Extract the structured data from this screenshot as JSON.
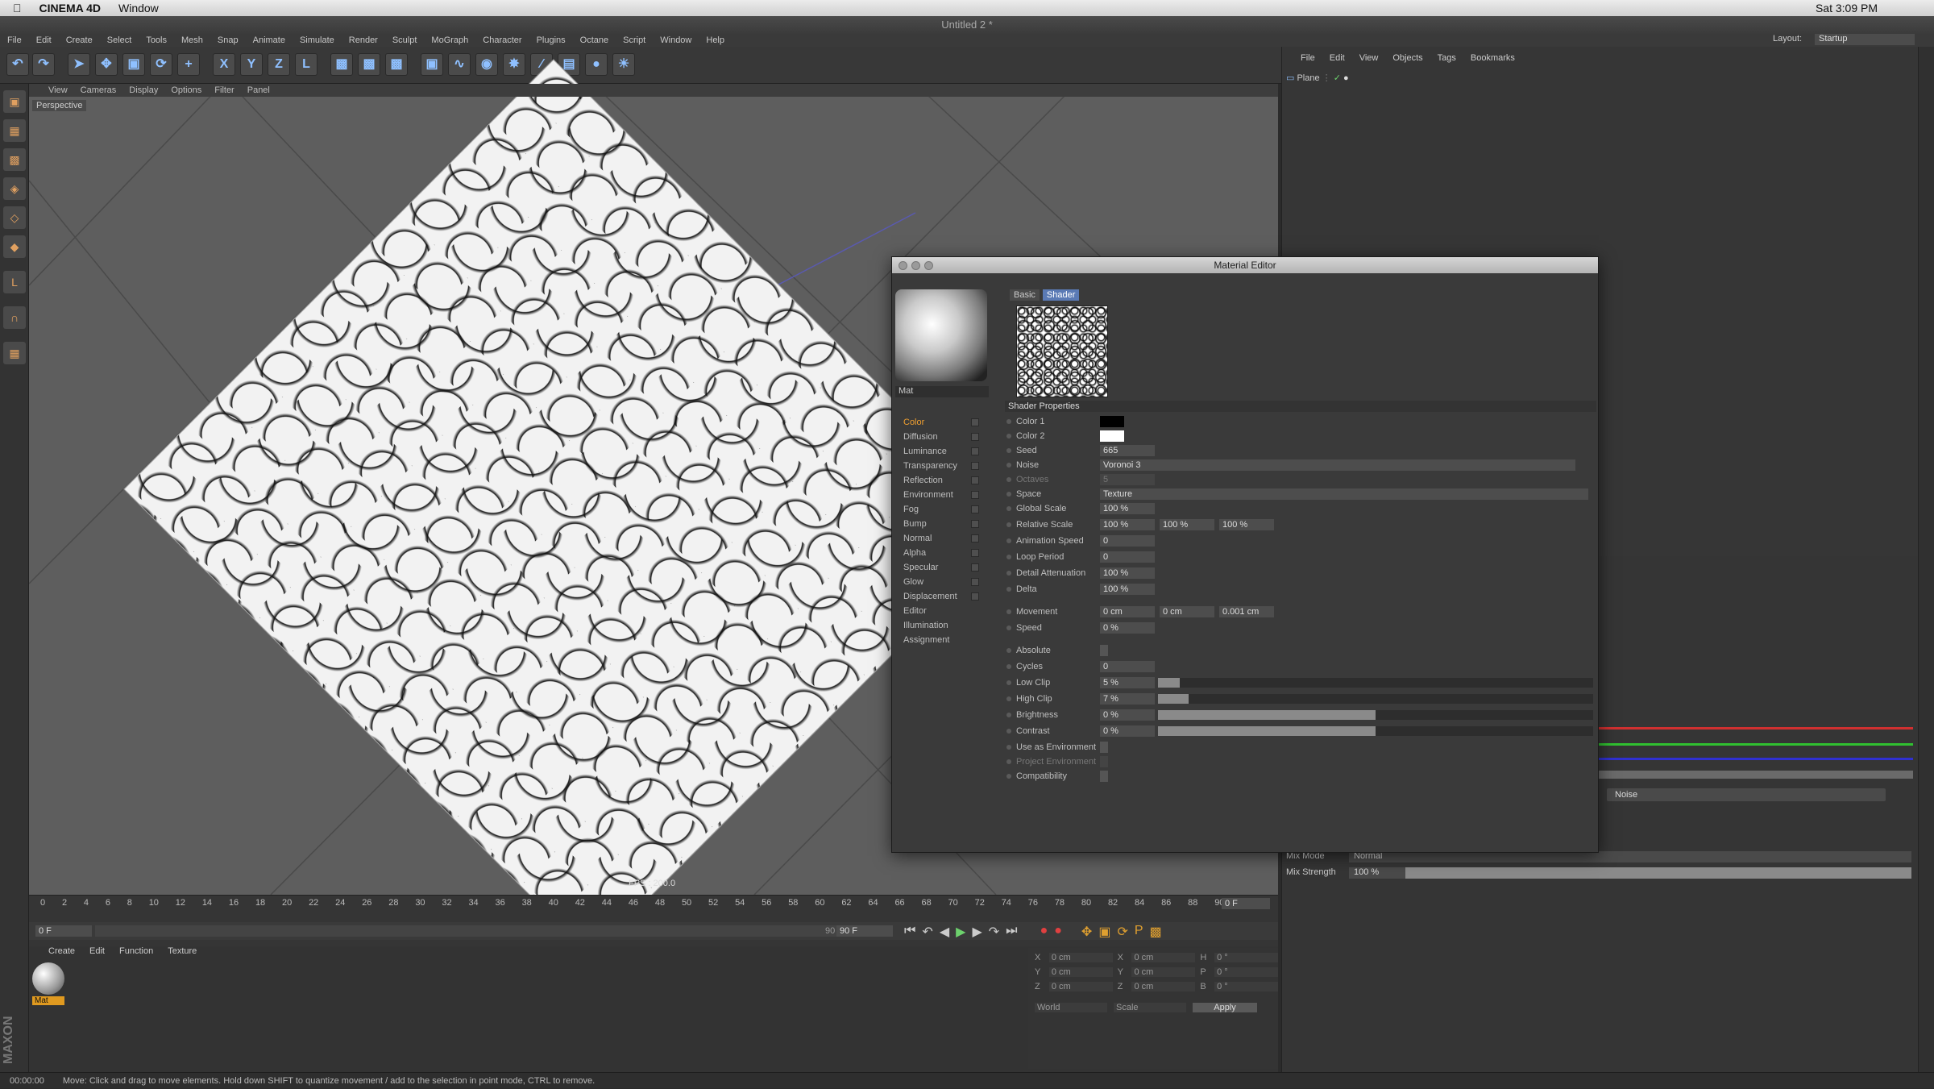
{
  "mac": {
    "app": "CINEMA 4D",
    "menu": "Window",
    "right": "Sat 3:09 PM"
  },
  "window": {
    "title": "Untitled 2 *"
  },
  "appmenu": [
    "File",
    "Edit",
    "Create",
    "Select",
    "Tools",
    "Mesh",
    "Snap",
    "Animate",
    "Simulate",
    "Render",
    "Sculpt",
    "MoGraph",
    "Character",
    "Plugins",
    "Octane",
    "Script",
    "Window",
    "Help"
  ],
  "layout": {
    "label": "Layout:",
    "value": "Startup"
  },
  "viewport": {
    "menu": [
      "View",
      "Cameras",
      "Display",
      "Options",
      "Filter",
      "Panel"
    ],
    "label": "Perspective",
    "fps": "FPS : 200.0"
  },
  "timeline": {
    "ticks": [
      "0",
      "2",
      "4",
      "6",
      "8",
      "10",
      "12",
      "14",
      "16",
      "18",
      "20",
      "22",
      "24",
      "26",
      "28",
      "30",
      "32",
      "34",
      "36",
      "38",
      "40",
      "42",
      "44",
      "46",
      "48",
      "50",
      "52",
      "54",
      "56",
      "58",
      "60",
      "62",
      "64",
      "66",
      "68",
      "70",
      "72",
      "74",
      "76",
      "78",
      "80",
      "82",
      "84",
      "86",
      "88",
      "90"
    ],
    "end_frame": "0 F",
    "start": "0 F",
    "max": "90 F",
    "max2": "90 F"
  },
  "material_manager": {
    "menu": [
      "Create",
      "Edit",
      "Function",
      "Texture"
    ],
    "mat_name": "Mat"
  },
  "coords": {
    "rows": [
      [
        "X",
        "0 cm",
        "X",
        "0 cm",
        "H",
        "0 °"
      ],
      [
        "Y",
        "0 cm",
        "Y",
        "0 cm",
        "P",
        "0 °"
      ],
      [
        "Z",
        "0 cm",
        "Z",
        "0 cm",
        "B",
        "0 °"
      ]
    ],
    "world": "World",
    "scale": "Scale",
    "apply": "Apply"
  },
  "status": {
    "time": "00:00:00",
    "message": "Move: Click and drag to move elements. Hold down SHIFT to quantize movement / add to the selection in point mode, CTRL to remove."
  },
  "objects": {
    "menu": [
      "File",
      "Edit",
      "View",
      "Objects",
      "Tags",
      "Bookmarks"
    ],
    "plane": "Plane"
  },
  "attributes": {
    "noise_button": "Noise",
    "mix_mode_label": "Mix Mode",
    "mix_mode": "Normal",
    "mix_strength_label": "Mix Strength",
    "mix_strength": "100 %",
    "mix_strength_value": 1.0
  },
  "material_editor": {
    "title": "Material Editor",
    "mat_name": "Mat",
    "tabs": [
      "Basic",
      "Shader"
    ],
    "section": "Shader Properties",
    "channels": [
      "Color",
      "Diffusion",
      "Luminance",
      "Transparency",
      "Reflection",
      "Environment",
      "Fog",
      "Bump",
      "Normal",
      "Alpha",
      "Specular",
      "Glow",
      "Displacement",
      "Editor",
      "Illumination",
      "Assignment"
    ],
    "props": {
      "color1": "Color 1",
      "color2": "Color 2",
      "seed": "Seed",
      "seed_val": "665",
      "noise": "Noise",
      "noise_val": "Voronoi 3",
      "octaves": "Octaves",
      "octaves_val": "5",
      "space": "Space",
      "space_val": "Texture",
      "global_scale": "Global Scale",
      "global_scale_val": "100 %",
      "relative_scale": "Relative Scale",
      "rs1": "100 %",
      "rs2": "100 %",
      "rs3": "100 %",
      "anim_speed": "Animation Speed",
      "anim_speed_val": "0",
      "loop_period": "Loop Period",
      "loop_period_val": "0",
      "detail_att": "Detail Attenuation",
      "detail_att_val": "100 %",
      "delta": "Delta",
      "delta_val": "100 %",
      "movement": "Movement",
      "mv1": "0 cm",
      "mv2": "0 cm",
      "mv3": "0.001 cm",
      "speed": "Speed",
      "speed_val": "0 %",
      "absolute": "Absolute",
      "cycles": "Cycles",
      "cycles_val": "0",
      "low_clip": "Low Clip",
      "low_clip_val": "5 %",
      "low_clip_level": 0.05,
      "high_clip": "High Clip",
      "high_clip_val": "7 %",
      "high_clip_level": 0.07,
      "brightness": "Brightness",
      "brightness_val": "0 %",
      "brightness_level": 0.5,
      "contrast": "Contrast",
      "contrast_val": "0 %",
      "contrast_level": 0.5,
      "use_env": "Use as Environment",
      "proj_env": "Project Environment",
      "compat": "Compatibility"
    }
  },
  "colors": {
    "accent": "#f0a030",
    "color1": "#000000",
    "color2": "#ffffff"
  }
}
